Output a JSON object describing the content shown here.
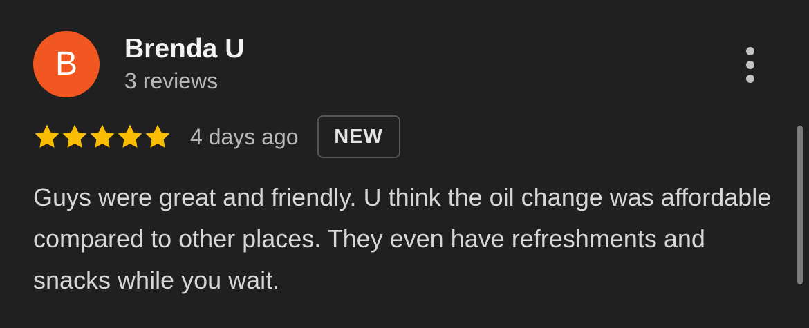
{
  "review": {
    "avatar_initial": "B",
    "author_name": "Brenda U",
    "review_count": "3 reviews",
    "rating": 5,
    "rating_scale": 5,
    "date": "4 days ago",
    "badge": "NEW",
    "text": "Guys were great and friendly. U think the oil change was affordable compared to other places. They even have refreshments and snacks while you wait."
  },
  "icons": {
    "more": "more-vertical-icon",
    "star": "star-icon"
  },
  "colors": {
    "background": "#202020",
    "avatar": "#f25722",
    "star": "#fbbc04",
    "badge_border": "#555555"
  }
}
